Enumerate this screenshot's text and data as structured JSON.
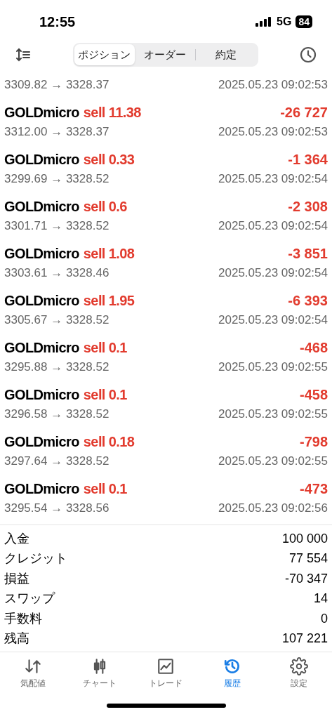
{
  "status_bar": {
    "time": "12:55",
    "network": "5G",
    "battery": "84"
  },
  "segments": [
    {
      "label": "ポジション",
      "selected": true
    },
    {
      "label": "オーダー",
      "selected": false
    },
    {
      "label": "約定",
      "selected": false
    }
  ],
  "deals": [
    {
      "prices": "3309.82 → 3328.37",
      "time": "2025.05.23 09:02:53"
    },
    {
      "symbol": "GOLDmicro",
      "side": "sell 11.38",
      "profit": "-26 727",
      "prices": "3312.00 → 3328.37",
      "time": "2025.05.23 09:02:53"
    },
    {
      "symbol": "GOLDmicro",
      "side": "sell 0.33",
      "profit": "-1 364",
      "prices": "3299.69 → 3328.52",
      "time": "2025.05.23 09:02:54"
    },
    {
      "symbol": "GOLDmicro",
      "side": "sell 0.6",
      "profit": "-2 308",
      "prices": "3301.71 → 3328.52",
      "time": "2025.05.23 09:02:54"
    },
    {
      "symbol": "GOLDmicro",
      "side": "sell 1.08",
      "profit": "-3 851",
      "prices": "3303.61 → 3328.46",
      "time": "2025.05.23 09:02:54"
    },
    {
      "symbol": "GOLDmicro",
      "side": "sell 1.95",
      "profit": "-6 393",
      "prices": "3305.67 → 3328.52",
      "time": "2025.05.23 09:02:54"
    },
    {
      "symbol": "GOLDmicro",
      "side": "sell 0.1",
      "profit": "-468",
      "prices": "3295.88 → 3328.52",
      "time": "2025.05.23 09:02:55"
    },
    {
      "symbol": "GOLDmicro",
      "side": "sell 0.1",
      "profit": "-458",
      "prices": "3296.58 → 3328.52",
      "time": "2025.05.23 09:02:55"
    },
    {
      "symbol": "GOLDmicro",
      "side": "sell 0.18",
      "profit": "-798",
      "prices": "3297.64 → 3328.52",
      "time": "2025.05.23 09:02:55"
    },
    {
      "symbol": "GOLDmicro",
      "side": "sell 0.1",
      "profit": "-473",
      "prices": "3295.54 → 3328.56",
      "time": "2025.05.23 09:02:56"
    }
  ],
  "summary": [
    {
      "label": "入金",
      "value": "100 000"
    },
    {
      "label": "クレジット",
      "value": "77 554"
    },
    {
      "label": "損益",
      "value": "-70 347"
    },
    {
      "label": "スワップ",
      "value": "14"
    },
    {
      "label": "手数料",
      "value": "0"
    },
    {
      "label": "残高",
      "value": "107 221"
    }
  ],
  "tab_bar": [
    {
      "kind": "quotes",
      "label": "気配値",
      "selected": false
    },
    {
      "kind": "chart",
      "label": "チャート",
      "selected": false
    },
    {
      "kind": "trade",
      "label": "トレード",
      "selected": false
    },
    {
      "kind": "history",
      "label": "履歴",
      "selected": true
    },
    {
      "kind": "settings",
      "label": "設定",
      "selected": false
    }
  ]
}
